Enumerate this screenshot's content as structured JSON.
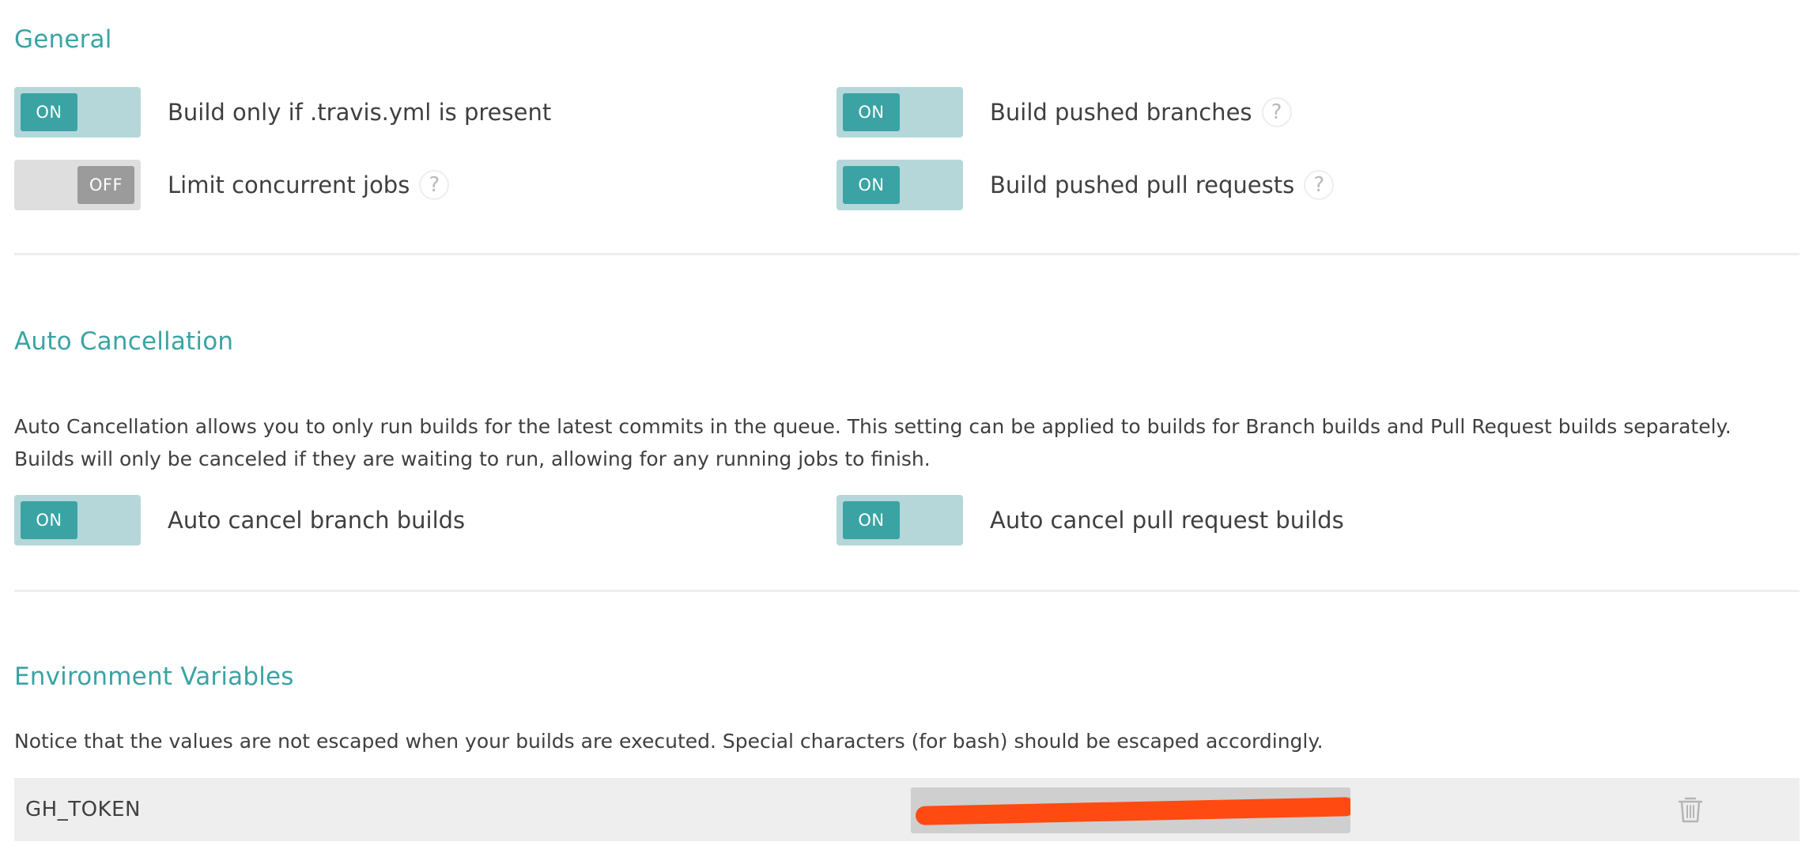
{
  "general": {
    "title": "General",
    "settings": [
      {
        "label": "Build only if .travis.yml is present",
        "state": "ON",
        "has_help": false
      },
      {
        "label": "Build pushed branches",
        "state": "ON",
        "has_help": true
      },
      {
        "label": "Limit concurrent jobs",
        "state": "OFF",
        "has_help": true
      },
      {
        "label": "Build pushed pull requests",
        "state": "ON",
        "has_help": true
      }
    ]
  },
  "auto_cancellation": {
    "title": "Auto Cancellation",
    "description": "Auto Cancellation allows you to only run builds for the latest commits in the queue. This setting can be applied to builds for Branch builds and Pull Request builds separately. Builds will only be canceled if they are waiting to run, allowing for any running jobs to finish.",
    "settings": [
      {
        "label": "Auto cancel branch builds",
        "state": "ON"
      },
      {
        "label": "Auto cancel pull request builds",
        "state": "ON"
      }
    ]
  },
  "environment_variables": {
    "title": "Environment Variables",
    "notice": "Notice that the values are not escaped when your builds are executed. Special characters (for bash) should be escaped accordingly.",
    "variables": [
      {
        "name": "GH_TOKEN",
        "icon": "trash-icon"
      }
    ]
  },
  "help_symbol": "?",
  "colors": {
    "accent": "#3ba3a4",
    "toggle_on_track": "#b6d7da",
    "toggle_off_track": "#dedede",
    "toggle_off_knob": "#9b9b9b",
    "redaction": "#ff4a12"
  }
}
